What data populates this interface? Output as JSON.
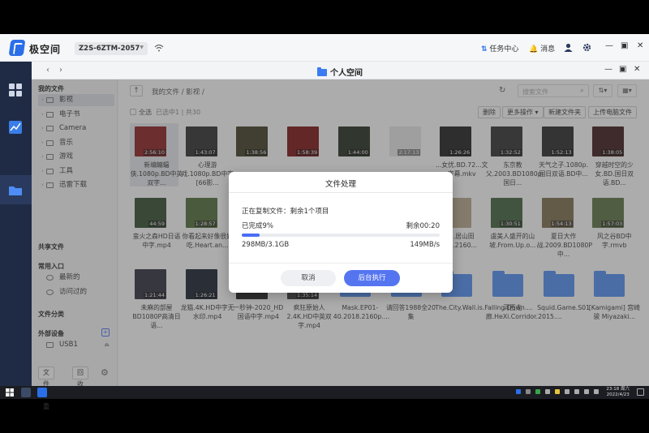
{
  "app": {
    "name": "极空间",
    "device": "Z2S-6ZTM-2057",
    "task_center": "任务中心",
    "messages": "消息"
  },
  "window": {
    "title": "个人空间"
  },
  "sidebar": {
    "my_files": "我的文件",
    "folders": [
      "影视",
      "电子书",
      "Camera",
      "音乐",
      "游戏",
      "工具",
      "迅雷下载"
    ],
    "shared": "共享文件",
    "quick_entry": "常用入口",
    "quick_items": [
      "最新的",
      "访问过的"
    ],
    "file_category": "文件分类",
    "external": "外部设备",
    "usb": "USB1",
    "bottom_buttons": [
      "文件去重",
      "回收站"
    ]
  },
  "main": {
    "breadcrumb": "我的文件 / 影视 /",
    "search_placeholder": "搜索文件",
    "select_all": "全选",
    "selection_info": "已选中1 | 共30",
    "actions": [
      "删除",
      "更多操作 ▾",
      "新建文件夹",
      "上传电脑文件"
    ]
  },
  "files": [
    {
      "name": "新编蝙蝠侠.1080p.BD中英双字...",
      "duration": "2:56:10",
      "kind": "video",
      "color": "#8a1b1b",
      "selected": true
    },
    {
      "name": "心理游戏.1080p.BD中字[66影...",
      "duration": "1:43:07",
      "kind": "video",
      "color": "#2a2a2a"
    },
    {
      "name": "",
      "duration": "1:38:56",
      "kind": "video",
      "color": "#3b3a1f"
    },
    {
      "name": "",
      "duration": "1:58:39",
      "kind": "video",
      "color": "#7a0d0d"
    },
    {
      "name": "",
      "duration": "1:44:00",
      "kind": "video",
      "color": "#1f2a1a"
    },
    {
      "name": "",
      "duration": "2:17:13",
      "kind": "video",
      "color": "#e7e7e7"
    },
    {
      "name": "...女优.BD.72...文字幕.mkv",
      "duration": "1:26:26",
      "kind": "video",
      "color": "#1b1b1b"
    },
    {
      "name": "东京教父.2003.BD1080p.国日...",
      "duration": "1:32:52",
      "kind": "video",
      "color": "#2c2c2c"
    },
    {
      "name": "天气之子.1080p.国日双语.BD中...",
      "duration": "1:52:13",
      "kind": "video",
      "color": "#262626"
    },
    {
      "name": "穿越时空的少女.BD.国日双语.BD...",
      "duration": "1:38:05",
      "kind": "video",
      "color": "#3a1515"
    },
    {
      "name": "蛮火之森HD日语中字.mp4",
      "duration": "44:59",
      "kind": "video",
      "color": "#2f4a2a"
    },
    {
      "name": "你看起来好像很好吃.Heart.an...",
      "duration": "1:28:57",
      "kind": "video",
      "color": "#4e6a34"
    },
    {
      "name": "",
      "duration": "",
      "kind": "hidden",
      "color": "#888"
    },
    {
      "name": "",
      "duration": "",
      "kind": "hidden",
      "color": "#888"
    },
    {
      "name": "",
      "duration": "",
      "kind": "hidden",
      "color": "#888"
    },
    {
      "name": "",
      "duration": "",
      "kind": "hidden",
      "color": "#888"
    },
    {
      "name": "...居山田君.2160...",
      "duration": "",
      "kind": "video",
      "color": "#b9a68a"
    },
    {
      "name": "虞美人盛开的山坡.From.Up.o...",
      "duration": "1:30:51",
      "kind": "video",
      "color": "#3d5f3a"
    },
    {
      "name": "夏日大作战.2009.BD1080P中...",
      "duration": "1:54:13",
      "kind": "video",
      "color": "#7a6a4a"
    },
    {
      "name": "风之谷BD中字.rmvb",
      "duration": "1:57:03",
      "kind": "video",
      "color": "#5a7040"
    },
    {
      "name": "未麻的部屋BD1080P高清日语...",
      "duration": "1:21:44",
      "kind": "video",
      "color": "#2a2a3a"
    },
    {
      "name": "龙猫.4K.HD中字无水印.mp4",
      "duration": "1:26:21",
      "kind": "video",
      "color": "#111a2a"
    },
    {
      "name": "一秒钟-2020_HD国语中字.mp4",
      "duration": "",
      "kind": "video",
      "color": "#1a1a1a"
    },
    {
      "name": "疯狂原始人2.4K.HD中英双字.mp4",
      "duration": "1:35:14",
      "kind": "video",
      "color": "#333"
    },
    {
      "name": "Mask.EP01-40.2018.2160p....",
      "duration": "",
      "kind": "folder",
      "color": "#4d8df5"
    },
    {
      "name": "请回答1988全20集",
      "duration": "",
      "kind": "folder",
      "color": "#4d8df5"
    },
    {
      "name": "The.City.Wall.is.Falling.Down....",
      "duration": "",
      "kind": "folder",
      "color": "#4d8df5"
    },
    {
      "name": "河西走廊.HeXi.Corridor.2015....",
      "duration": "",
      "kind": "folder",
      "color": "#4d8df5"
    },
    {
      "name": "Squid.Game.S01",
      "duration": "",
      "kind": "folder",
      "color": "#4d8df5"
    },
    {
      "name": "[Kamigami] 宫崎骏 Miyazaki...",
      "duration": "",
      "kind": "folder",
      "color": "#4d8df5"
    }
  ],
  "dialog": {
    "title": "文件处理",
    "status": "正在复制文件：剩余1个项目",
    "done_label": "已完成9%",
    "remaining_time": "剩余00:20",
    "progress_percent": 9,
    "size_progress": "298MB/3.1GB",
    "speed": "149MB/s",
    "cancel": "取消",
    "background": "后台执行"
  },
  "taskbar": {
    "time": "23:18 周六",
    "date": "2022/4/23"
  },
  "colors": {
    "accent": "#4a6ef5",
    "rail": "#1f2b45",
    "folder": "#4d8df5"
  }
}
